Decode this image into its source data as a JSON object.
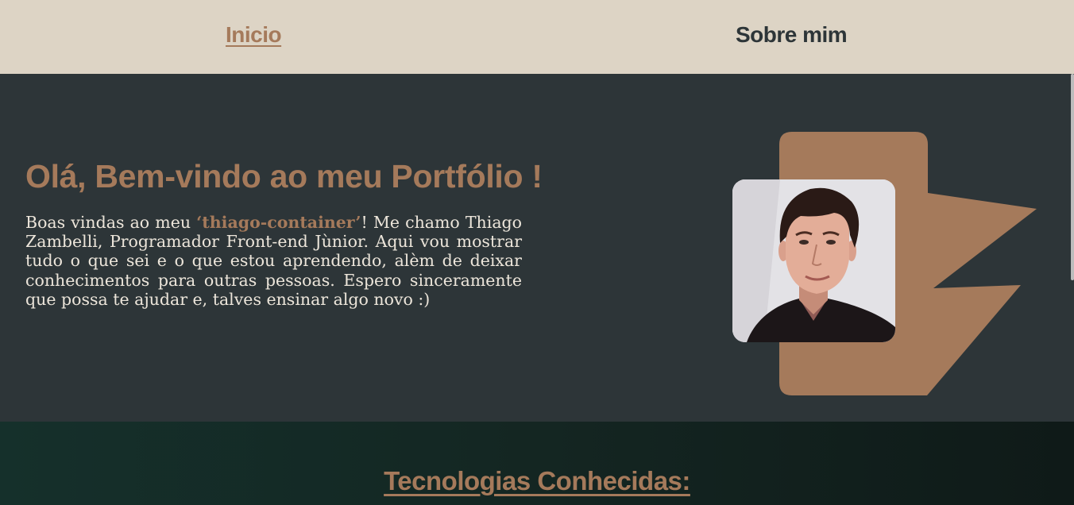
{
  "nav": {
    "home_label": "Inicio",
    "about_label": "Sobre mim"
  },
  "hero": {
    "title": "Olá, Bem-vindo ao meu Portfólio !",
    "text_before": "Boas vindas ao meu ",
    "highlight": "‘thiago-container’",
    "text_after": "! Me chamo Thiago Zambelli, Programador Front-end Jùnior. Aqui vou mostrar tudo o que sei e o que estou aprendendo, alèm de deixar conhecimentos para outras pessoas. Espero sinceramente que possa te ajudar e, talves ensinar algo novo :)",
    "photo_icon": "profile-photo"
  },
  "tech": {
    "title": "Tecnologias Conhecidas:"
  },
  "colors": {
    "nav_bg": "#ddd4c5",
    "hero_bg": "#2d3538",
    "accent": "#a57a5b",
    "text_light": "#ece5da",
    "tech_bg": "#142622"
  }
}
